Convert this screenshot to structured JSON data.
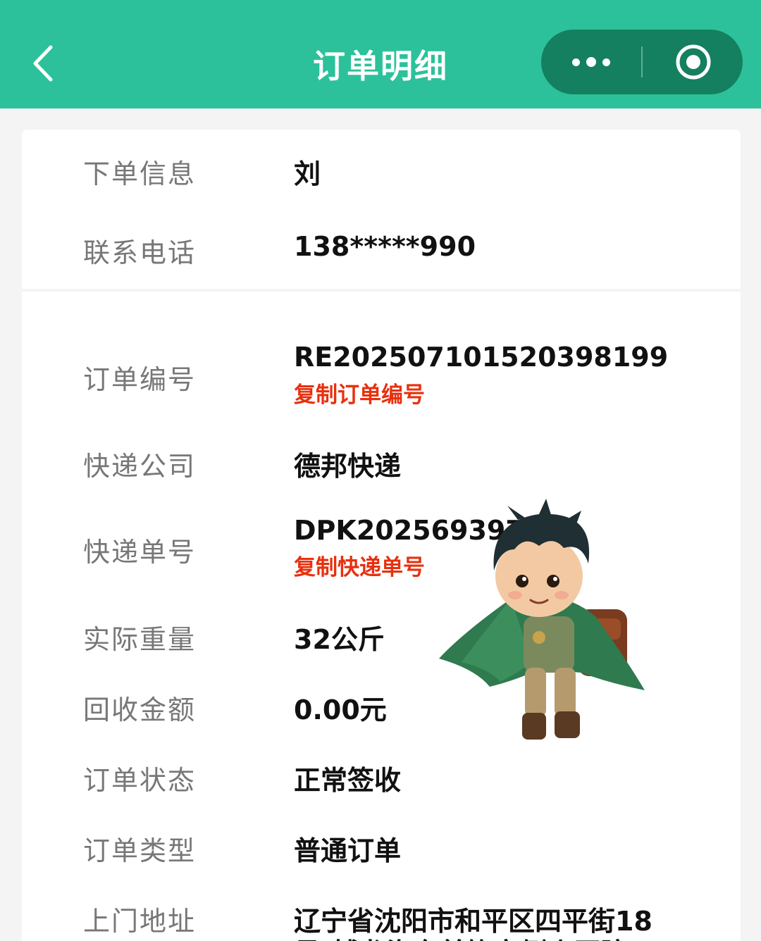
{
  "header": {
    "title": "订单明细",
    "back_icon": "chevron-left-icon",
    "more_icon": "more-dots-icon",
    "close_icon": "target-close-icon",
    "bg_color": "#2cc19a",
    "capsule_color": "#14805f"
  },
  "customer": {
    "name_label": "下单信息",
    "name_value": "刘",
    "phone_label": "联系电话",
    "phone_value": "138*****990"
  },
  "order": {
    "order_no_label": "订单编号",
    "order_no_value": "RE2025071015203981​99",
    "copy_order_no": "复制订单编号",
    "courier_label": "快递公司",
    "courier_value": "德邦快递",
    "tracking_label": "快递单号",
    "tracking_value": "DPK2025693971",
    "copy_tracking": "复制快递单号",
    "weight_label": "实际重量",
    "weight_value": "32公斤",
    "amount_label": "回收金额",
    "amount_value": "0.00元",
    "status_label": "订单状态",
    "status_value": "正常签收",
    "type_label": "订单类型",
    "type_value": "普通订单",
    "address_label": "上门地址",
    "address_line1": "辽宁省沈阳市和平区四平街18",
    "address_line2": "号(博龙海东美饰市侧小区院"
  },
  "colors": {
    "link_red": "#e8300f",
    "label_gray": "#777777"
  },
  "mascot_icon": "cartoon-boy-with-cape-icon"
}
